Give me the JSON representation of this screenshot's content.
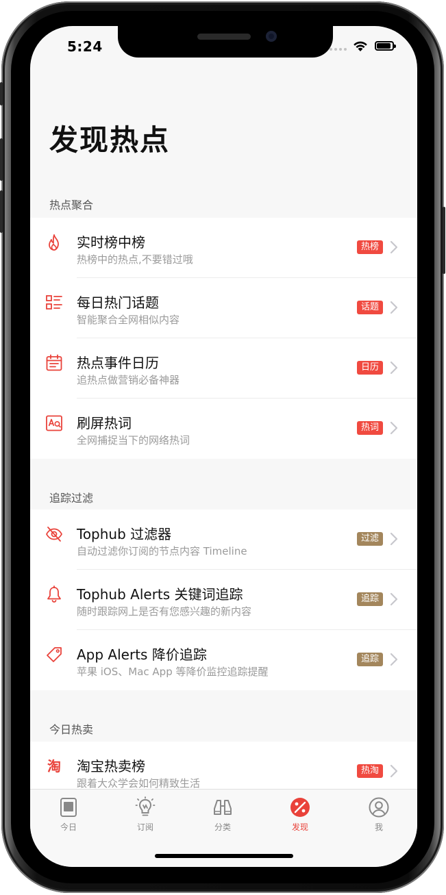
{
  "status": {
    "time": "5:24"
  },
  "page": {
    "title": "发现热点"
  },
  "sections": [
    {
      "label": "热点聚合",
      "items": [
        {
          "title": "实时榜中榜",
          "subtitle": "热榜中的热点,不要错过哦",
          "badge": "热榜",
          "icon": "flame-icon",
          "badge_color": "#f04a40"
        },
        {
          "title": "每日热门话题",
          "subtitle": "智能聚合全网相似内容",
          "badge": "话题",
          "icon": "list-icon",
          "badge_color": "#f04a40"
        },
        {
          "title": "热点事件日历",
          "subtitle": "追热点做营销必备神器",
          "badge": "日历",
          "icon": "calendar-icon",
          "badge_color": "#f04a40"
        },
        {
          "title": "刷屏热词",
          "subtitle": "全网捕捉当下的网络热词",
          "badge": "热词",
          "icon": "word-search-icon",
          "badge_color": "#f04a40"
        }
      ]
    },
    {
      "label": "追踪过滤",
      "items": [
        {
          "title": "Tophub 过滤器",
          "subtitle": "自动过滤你订阅的节点内容 Timeline",
          "badge": "过滤",
          "icon": "eye-off-icon",
          "badge_color": "#a3865c"
        },
        {
          "title": "Tophub Alerts 关键词追踪",
          "subtitle": "随时跟踪网上是否有您感兴趣的新内容",
          "badge": "追踪",
          "icon": "bell-icon",
          "badge_color": "#a3865c"
        },
        {
          "title": "App Alerts 降价追踪",
          "subtitle": "苹果 iOS、Mac App 等降价监控追踪提醒",
          "badge": "追踪",
          "icon": "price-tag-icon",
          "badge_color": "#a3865c"
        }
      ]
    },
    {
      "label": "今日热卖",
      "items": [
        {
          "title": "淘宝热卖榜",
          "subtitle": "跟着大众学会如何精致生活",
          "badge": "热淘",
          "icon": "taobao-icon",
          "icon_text": "淘",
          "badge_color": "#f04a40"
        }
      ]
    }
  ],
  "tabbar": {
    "items": [
      {
        "label": "今日",
        "icon": "today-icon"
      },
      {
        "label": "订阅",
        "icon": "bulb-icon"
      },
      {
        "label": "分类",
        "icon": "binoculars-icon"
      },
      {
        "label": "发现",
        "icon": "discover-icon",
        "active": true
      },
      {
        "label": "我",
        "icon": "profile-icon"
      }
    ]
  },
  "colors": {
    "accent": "#e9423a",
    "badge_red": "#f04a40",
    "badge_brown": "#a3865c"
  }
}
